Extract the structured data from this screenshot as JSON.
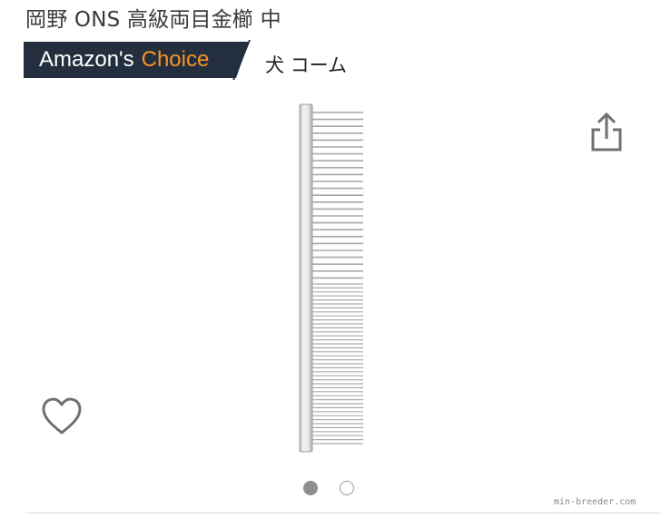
{
  "product": {
    "title": "岡野 ONS 高級両目金櫛 中"
  },
  "badge": {
    "brand": "Amazon's",
    "choice": "Choice",
    "category": "犬 コーム"
  },
  "colors": {
    "badge_bg": "#232f3e",
    "choice_accent": "#f79426",
    "icon_gray": "#707070"
  },
  "icons": {
    "share": "share-icon",
    "favorite": "heart-outline-icon"
  },
  "gallery": {
    "image_count": 2,
    "current_index": 1,
    "image_subject": "metal comb"
  },
  "watermark": {
    "text": "min-breeder.com"
  }
}
